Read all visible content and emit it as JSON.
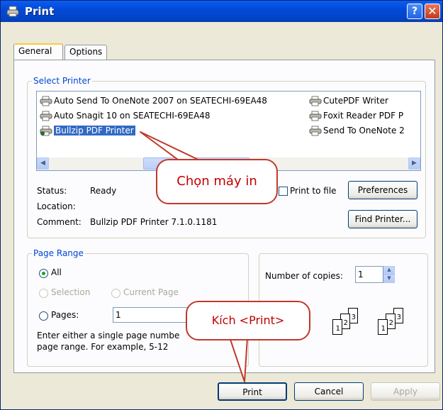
{
  "window": {
    "title": "Print"
  },
  "tabs": [
    {
      "label": "General"
    },
    {
      "label": "Options"
    }
  ],
  "select_printer": {
    "group_label": "Select Printer",
    "printers": [
      {
        "name": "Auto Send To OneNote 2007 on SEATECHI-69EA48"
      },
      {
        "name": "Auto Snagit 10 on SEATECHI-69EA48"
      },
      {
        "name": "Bullzip PDF Printer",
        "selected": true
      },
      {
        "name": "CutePDF Writer"
      },
      {
        "name": "Foxit Reader PDF P"
      },
      {
        "name": "Send To OneNote 2"
      }
    ],
    "status_label": "Status:",
    "status_value": "Ready",
    "location_label": "Location:",
    "comment_label": "Comment:",
    "comment_value": "Bullzip PDF Printer 7.1.0.1181",
    "print_to_file_label": "Print to file",
    "preferences_label": "Preferences",
    "find_printer_label": "Find Printer..."
  },
  "page_range": {
    "group_label": "Page Range",
    "all_label": "All",
    "selection_label": "Selection",
    "current_page_label": "Current Page",
    "pages_label": "Pages:",
    "pages_value": "1",
    "help_line1": "Enter either a single page numbe",
    "help_line2": "page range.  For example, 5-12"
  },
  "copies": {
    "label": "Number of copies:",
    "value": "1",
    "collate_pages": [
      "1",
      "2",
      "3"
    ]
  },
  "buttons": {
    "print": "Print",
    "cancel": "Cancel",
    "apply": "Apply"
  },
  "annotations": {
    "choose_printer": "Chọn máy in",
    "click_print": "Kích <Print>"
  },
  "colors": {
    "callout_border": "#c0392b",
    "callout_text": "#c00000",
    "titlebar": "#0a5ef3"
  }
}
